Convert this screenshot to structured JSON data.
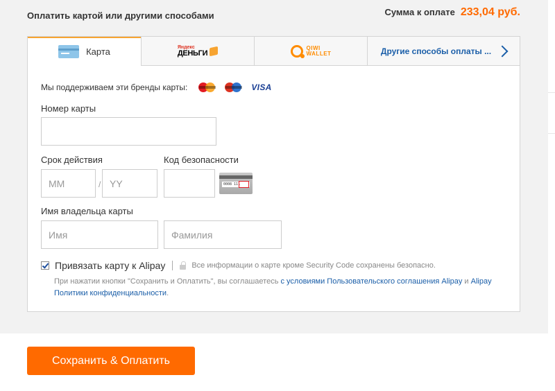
{
  "header": {
    "title": "Оплатить картой или другими способами",
    "sum_label": "Сумма к оплате",
    "sum_amount": "233,04 руб."
  },
  "tabs": [
    {
      "label": "Карта",
      "icon": "credit-card-icon",
      "active": true
    },
    {
      "logo_small": "Яндекс",
      "logo_big": "ДЕНЬГИ",
      "icon": "yandex-money-logo"
    },
    {
      "logo_line1": "QIWI",
      "logo_line2": "WALLET",
      "icon": "qiwi-wallet-logo"
    },
    {
      "label": "Другие способы оплаты ...",
      "icon": "chevron-right-icon"
    }
  ],
  "form": {
    "brands_label": "Мы поддерживаем эти бренды карты:",
    "brands": [
      "mastercard-icon",
      "maestro-icon",
      "visa-icon"
    ],
    "visa_text": "VISA",
    "card_number_label": "Номер карты",
    "card_number_value": "",
    "expiry_label": "Срок действия",
    "month_placeholder": "MM",
    "slash": "/",
    "year_placeholder": "YY",
    "cvv_label": "Код безопасности",
    "cvv_value": "",
    "cvv_image_text": "0008 111",
    "holder_label": "Имя владельца карты",
    "first_name_placeholder": "Имя",
    "last_name_placeholder": "Фамилия",
    "bind_checked": true,
    "bind_label": "Привязать карту к Alipay",
    "secure_note": "Все информации о карте кроме Security Code сохранены безопасно.",
    "agreement_text_1": "При нажатии кнопки \"Сохранить и Оплатить\", вы соглашаетесь ",
    "agreement_link_1": "с условиями Пользовательского соглашения Alipay",
    "agreement_text_2": " и ",
    "agreement_link_2": "Alipay Политики конфиденциальности",
    "agreement_text_3": "."
  },
  "pay_button": {
    "label": "Сохранить & Оплатить"
  },
  "colors": {
    "accent": "#ff6a00",
    "link": "#1a5ea8",
    "tab_active_border": "#f7a431"
  }
}
